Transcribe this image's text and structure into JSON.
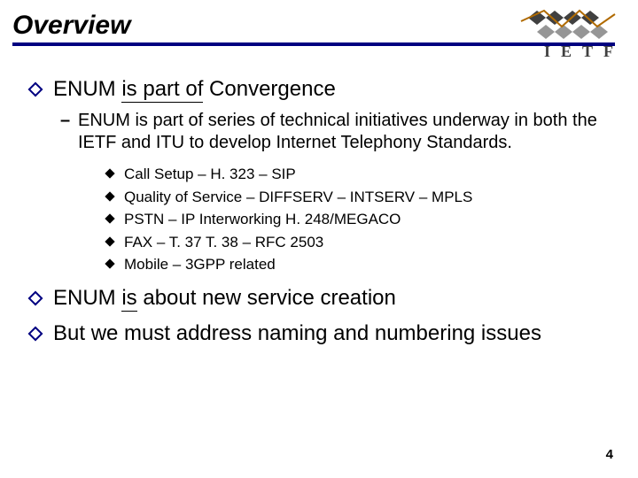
{
  "header": {
    "title": "Overview",
    "logo_letters": "IETF"
  },
  "bullets": {
    "item1": {
      "pre": "ENUM ",
      "u": "is part of",
      "post": "  Convergence",
      "sub": {
        "text": "ENUM is part of series of technical initiatives underway in both the IETF and ITU to develop Internet Telephony Standards.",
        "subsub": [
          "Call Setup – H. 323 – SIP",
          "Quality of Service – DIFFSERV – INTSERV – MPLS",
          "PSTN – IP Interworking   H. 248/MEGACO",
          "FAX – T. 37 T. 38 – RFC 2503",
          "Mobile – 3GPP related"
        ]
      }
    },
    "item2": {
      "pre": "ENUM ",
      "u": "is",
      "post": " about new service creation"
    },
    "item3": {
      "text": "But we must address naming and numbering issues"
    }
  },
  "page_number": "4"
}
